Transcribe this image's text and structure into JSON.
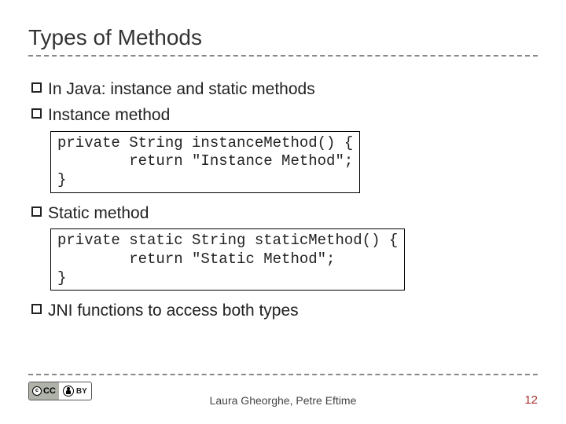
{
  "title": "Types of Methods",
  "bullets": {
    "b1": "In Java: instance and static methods",
    "b2": "Instance method",
    "b3": "Static method",
    "b4": "JNI functions to access both types"
  },
  "code": {
    "instance": "private String instanceMethod() {\n        return \"Instance Method\";\n}",
    "static": "private static String staticMethod() {\n        return \"Static Method\";\n}"
  },
  "footer": {
    "authors": "Laura Gheorghe, Petre Eftime",
    "page": "12",
    "cc_left": "CC",
    "by_label": "BY"
  }
}
